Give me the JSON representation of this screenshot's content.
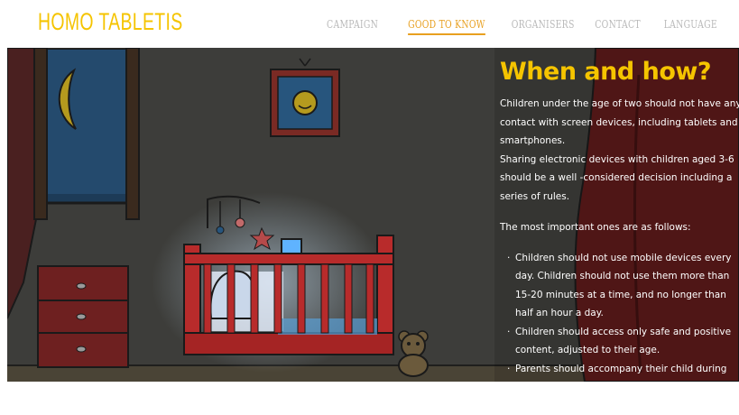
{
  "brand": {
    "logo": "HOMO TABLETIS"
  },
  "nav": {
    "items": [
      {
        "label": "CAMPAIGN",
        "active": false
      },
      {
        "label": "GOOD TO KNOW",
        "active": true
      },
      {
        "label": "ORGANISERS",
        "active": false
      },
      {
        "label": "CONTACT",
        "active": false
      },
      {
        "label": "LANGUAGE",
        "active": false
      }
    ]
  },
  "content": {
    "title": "When and how?",
    "para1": "Children under the age of two should not have any contact with screen devices, including tablets and smartphones.",
    "para2": "Sharing electronic devices with children aged 3-6 should be a well -considered decision including a series of rules.",
    "para3": "The most important ones are as follows:",
    "rules": [
      "Children should not use mobile devices every day. Children should not use them more than 15-20 minutes at a time, and no longer than half an hour a day.",
      "Children should access only safe and positive content, adjusted to their age.",
      "Parents should accompany their child during use of mobile devices, explain to them what they see on a"
    ]
  },
  "colors": {
    "accent": "#f5c400",
    "active_nav": "#e8a020",
    "scene_bg": "#3d3d3a",
    "curtain": "#5a1a1a",
    "furniture": "#8a2424"
  }
}
